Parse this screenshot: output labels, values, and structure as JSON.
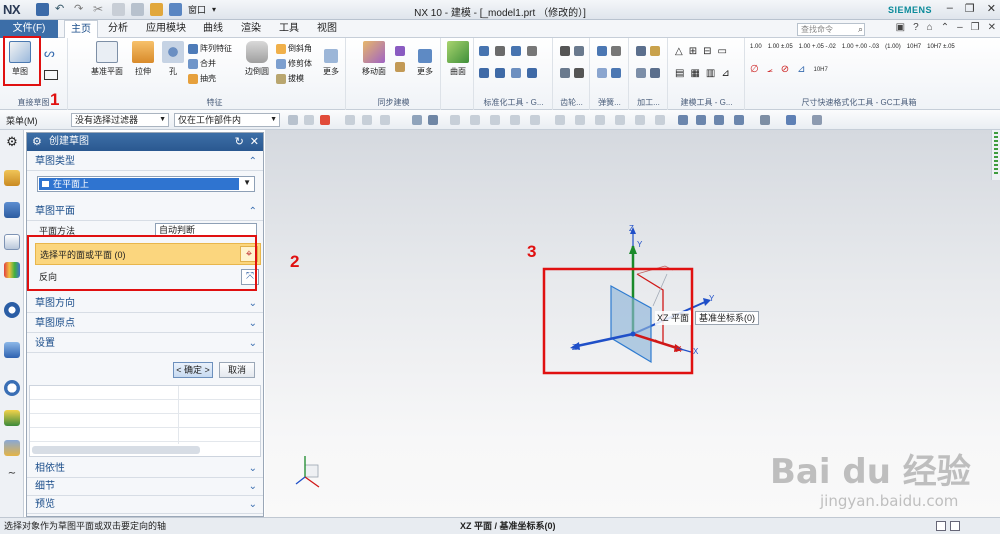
{
  "window": {
    "logo": "NX",
    "title": "NX 10 - 建模 - [_model1.prt （修改的）]",
    "brand": "SIEMENS",
    "window_menu": "窗口"
  },
  "tabs": {
    "file": "文件(F)",
    "items": [
      "主页",
      "分析",
      "应用模块",
      "曲线",
      "渲染",
      "工具",
      "视图"
    ],
    "search_placeholder": "查找命令"
  },
  "ribbon": {
    "direct_sketch": {
      "sketch_label": "草图",
      "group_label": "直接草图"
    },
    "feature": {
      "datum_plane": "基准平面",
      "extrude": "拉伸",
      "hole": "孔",
      "pattern_feature": "阵列特征",
      "unite": "合并",
      "shell": "抽壳",
      "edge_blend": "边倒圆",
      "chamfer": "倒斜角",
      "trim_body": "修剪体",
      "draft": "拔模",
      "more": "更多",
      "group_label": "特征"
    },
    "sync": {
      "move_face": "移动面",
      "more": "更多",
      "group_label": "同步建模"
    },
    "surface": {
      "label": "曲面"
    },
    "groups": [
      "标准化工具 - G...",
      "齿轮...",
      "弹簧...",
      "加工...",
      "建模工具 - G...",
      "尺寸快速格式化工具 - GC工具箱"
    ],
    "dim_labels": [
      "1.00",
      "1.00 ±.05",
      "1.00 +.05 -.02",
      "1.00 +.00 -.03",
      "(1.00)",
      "10H7",
      "10H7 ±.05",
      "10H7",
      "10H7"
    ]
  },
  "annotations": {
    "label_1": "1",
    "label_2": "2",
    "label_3": "3"
  },
  "selection_bar": {
    "menu": "菜单(M)",
    "filter": "没有选择过滤器",
    "scope": "仅在工作部件内"
  },
  "dialog": {
    "title": "创建草图",
    "sketch_type": {
      "header": "草图类型",
      "value": "在平面上"
    },
    "sketch_plane": {
      "header": "草图平面",
      "method_label": "平面方法",
      "method_value": "自动判断",
      "select_label": "选择平的面或平面 (0)",
      "reverse_label": "反向"
    },
    "sketch_orientation": "草图方向",
    "sketch_origin": "草图原点",
    "settings": "设置",
    "ok": "< 确定 >",
    "cancel": "取消",
    "dependency": "相依性",
    "details": "细节",
    "preview": "预览"
  },
  "graphics": {
    "axis_x": "X",
    "axis_y": "Y",
    "axis_z": "Z",
    "tooltip_plane": "XZ 平面",
    "tooltip_csys": "基准坐标系(0)"
  },
  "status": {
    "left": "选择对象作为草图平面或双击要定向的轴",
    "center": "XZ 平面 / 基准坐标系(0)"
  },
  "watermark": {
    "brand": "Bai du 经验",
    "url": "jingyan.baidu.com"
  },
  "colors": {
    "title_blue": "#2a5890",
    "highlight_row": "#fbd67e",
    "annotation_red": "#e01010",
    "plane_blue": "#8fb6d9",
    "axis_blue": "#1f4fc8",
    "axis_green": "#1a8a2a",
    "axis_red": "#d01818"
  }
}
